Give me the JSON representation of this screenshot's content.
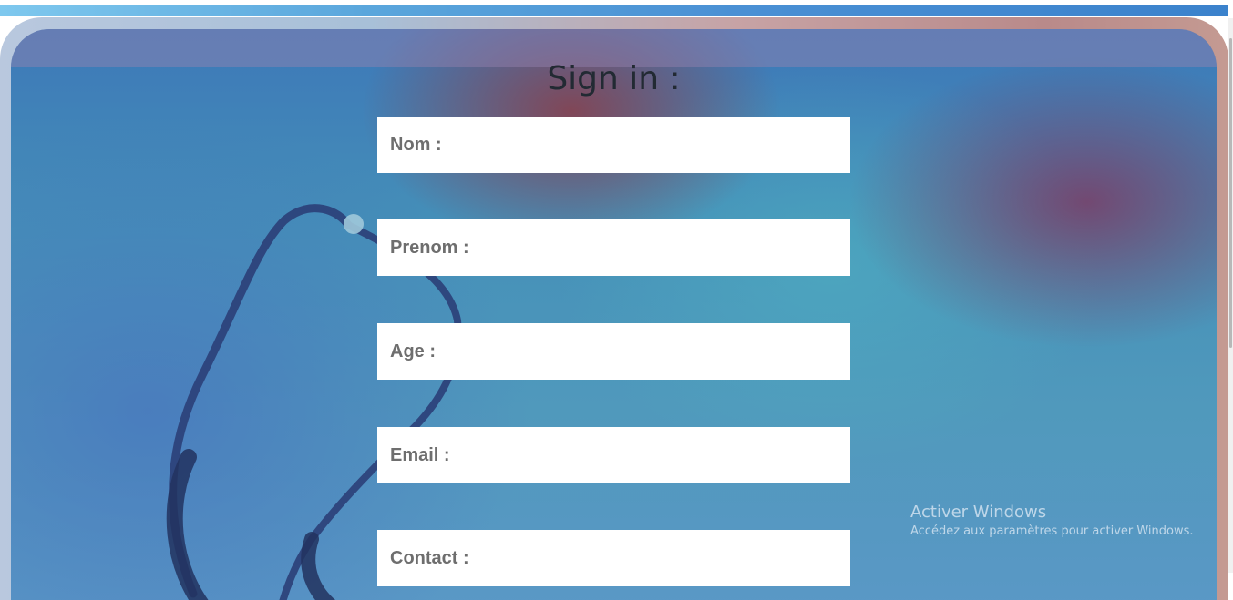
{
  "form": {
    "title": "Sign in :",
    "fields": [
      {
        "label": "Nom :",
        "value": ""
      },
      {
        "label": "Prenom :",
        "value": ""
      },
      {
        "label": "Age :",
        "value": ""
      },
      {
        "label": "Email :",
        "value": ""
      },
      {
        "label": "Contact :",
        "value": ""
      }
    ]
  },
  "watermark": {
    "title": "Activer Windows",
    "subtitle": "Accédez aux paramètres pour activer Windows."
  },
  "colors": {
    "accent_stripe": "#4a90d4",
    "panel_blue": "#4590b8",
    "field_bg": "#ffffff",
    "label_text": "#6e6e6e",
    "title_text": "#222a33"
  },
  "icons": {
    "background_illustration": "stethoscope-illustration"
  }
}
